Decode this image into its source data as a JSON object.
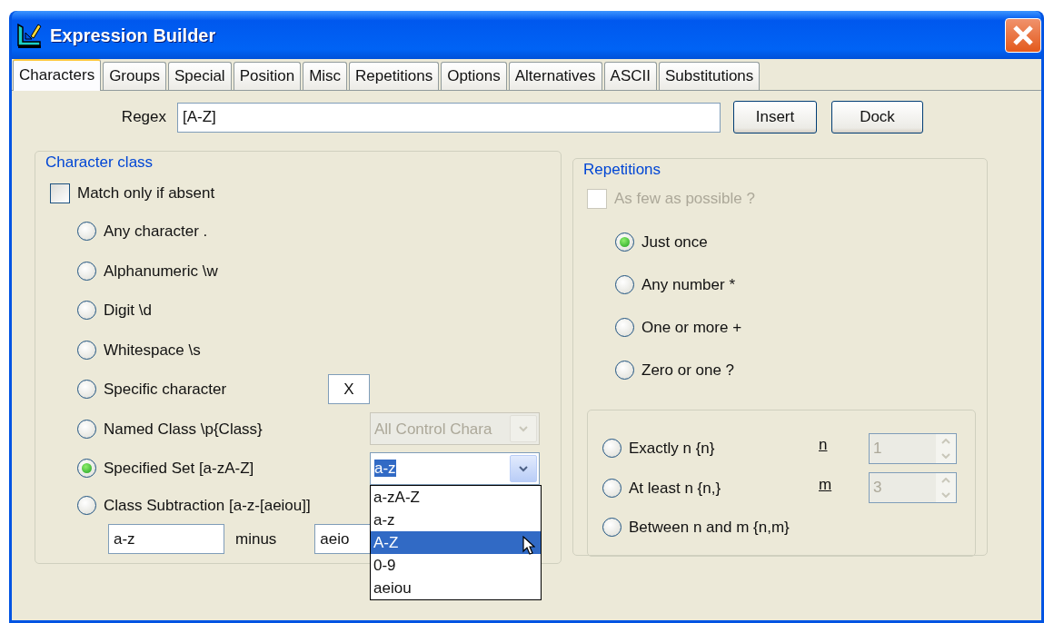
{
  "window": {
    "title": "Expression Builder"
  },
  "tabs": [
    {
      "label": "Characters",
      "selected": true
    },
    {
      "label": "Groups",
      "selected": false
    },
    {
      "label": "Special",
      "selected": false
    },
    {
      "label": "Position",
      "selected": false
    },
    {
      "label": "Misc",
      "selected": false
    },
    {
      "label": "Repetitions",
      "selected": false
    },
    {
      "label": "Options",
      "selected": false
    },
    {
      "label": "Alternatives",
      "selected": false
    },
    {
      "label": "ASCII",
      "selected": false
    },
    {
      "label": "Substitutions",
      "selected": false
    }
  ],
  "regex": {
    "label": "Regex",
    "value": "[A-Z]"
  },
  "buttons": [
    "Insert",
    "Dock"
  ],
  "character_class": {
    "title": "Character class",
    "match_absent": {
      "label": "Match only if absent",
      "checked": false
    },
    "options": [
      {
        "kind": "plain",
        "label": "Any character .",
        "selected": false
      },
      {
        "kind": "plain",
        "label": "Alphanumeric \\w",
        "selected": false
      },
      {
        "kind": "plain",
        "label": "Digit \\d",
        "selected": false
      },
      {
        "kind": "plain",
        "label": "Whitespace \\s",
        "selected": false
      },
      {
        "kind": "text",
        "label": "Specific character",
        "selected": false,
        "value": "X"
      },
      {
        "kind": "combo",
        "label": "Named Class \\p{Class}",
        "selected": false,
        "value": "All Control Chara",
        "disabled": true
      },
      {
        "kind": "combo",
        "label": "Specified Set [a-zA-Z]",
        "selected": true,
        "value": "a-z",
        "disabled": false,
        "expanded": true,
        "items": [
          {
            "label": "a-zA-Z",
            "highlighted": false
          },
          {
            "label": "a-z",
            "highlighted": false
          },
          {
            "label": "A-Z",
            "highlighted": true
          },
          {
            "label": "0-9",
            "highlighted": false
          },
          {
            "label": "aeiou",
            "highlighted": false
          }
        ]
      },
      {
        "kind": "subtraction",
        "label": "Class Subtraction [a-z-[aeiou]]",
        "selected": false,
        "from": "a-z",
        "minus": "minus",
        "to": "aeio"
      }
    ]
  },
  "repetitions": {
    "title": "Repetitions",
    "few_possible": {
      "label": "As few as possible ?",
      "checked": false,
      "disabled": true
    },
    "options": [
      {
        "kind": "plain",
        "label": "Just once",
        "selected": true
      },
      {
        "kind": "plain",
        "label": "Any number *",
        "selected": false
      },
      {
        "kind": "plain",
        "label": "One or more +",
        "selected": false
      },
      {
        "kind": "plain",
        "label": "Zero or one ?",
        "selected": false
      },
      {
        "kind": "count",
        "label": "Exactly n {n}",
        "selected": false,
        "spin_label": "n",
        "spin_value": "1",
        "disabled": true
      },
      {
        "kind": "count",
        "label": "At least n {n,}",
        "selected": false,
        "spin_label": "m",
        "spin_value": "3",
        "disabled": true
      },
      {
        "kind": "count",
        "label": "Between n and m {n,m}",
        "selected": false
      }
    ]
  }
}
